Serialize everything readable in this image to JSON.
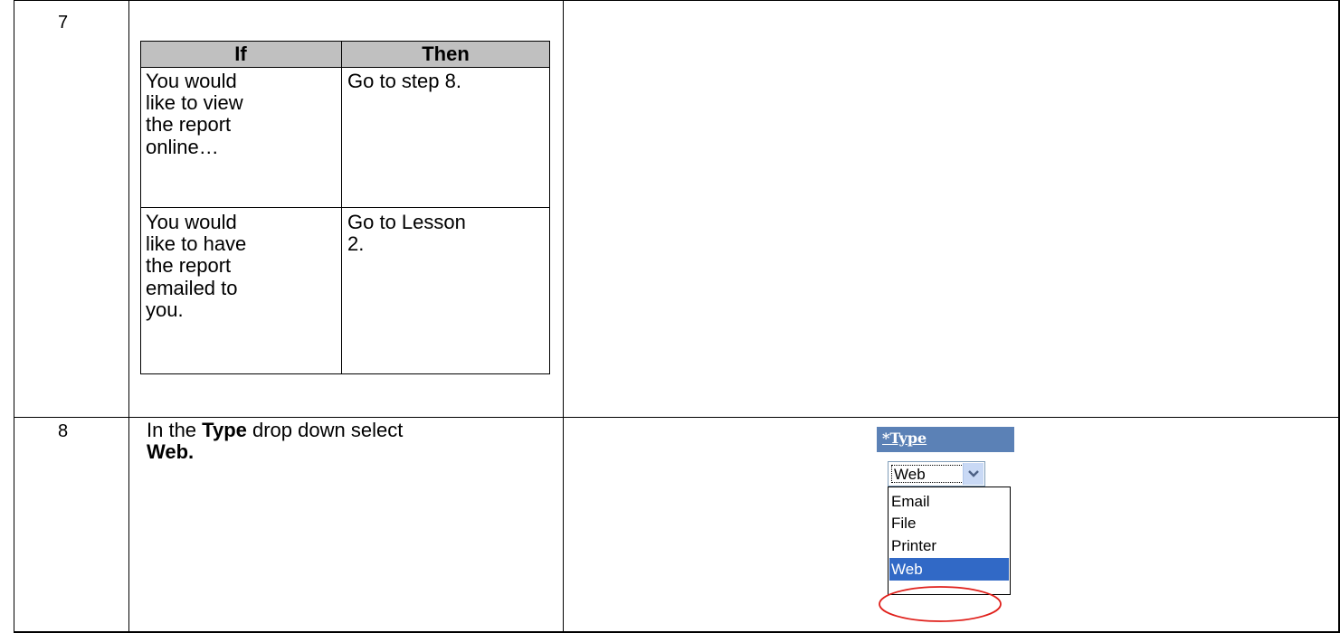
{
  "rows": [
    {
      "step": "7"
    },
    {
      "step": "8",
      "instruction": {
        "prefix": "In the ",
        "keyword": "Type",
        "middle": " drop down select",
        "value": "Web."
      }
    }
  ],
  "if_then_table": {
    "headers": {
      "if": "If",
      "then": "Then"
    },
    "rows": [
      {
        "if_lines": [
          "You would",
          "like to view",
          "the report",
          "online…"
        ],
        "then_lines": [
          "Go to step 8."
        ]
      },
      {
        "if_lines": [
          "You would",
          "like to have",
          "the report",
          "emailed to",
          "you."
        ],
        "then_lines": [
          "Go to Lesson",
          "2."
        ]
      }
    ]
  },
  "screenshot": {
    "field_label": "*Type",
    "selected_value": "Web",
    "options": [
      "Email",
      "File",
      "Printer",
      "Web"
    ],
    "highlighted_option": "Web",
    "colors": {
      "header_bg": "#5b81b6",
      "selection_bg": "#3169c6",
      "highlight_circle": "#e0201b"
    }
  }
}
